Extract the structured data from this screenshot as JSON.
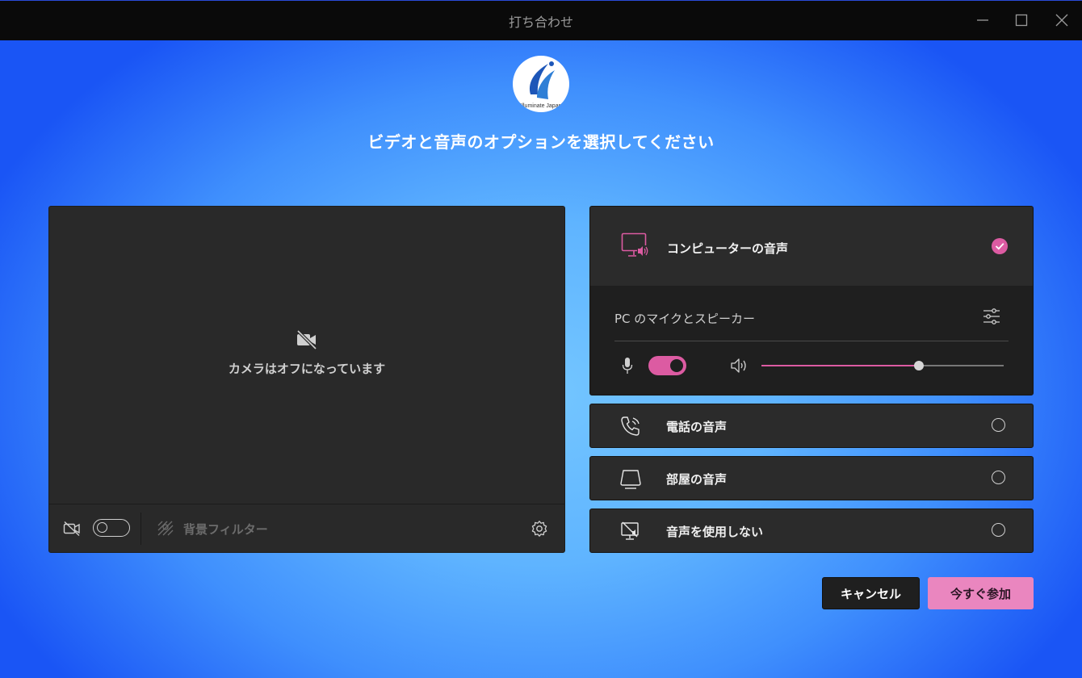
{
  "window": {
    "title": "打ち合わせ"
  },
  "logo": {
    "text": "Illuminate Japan"
  },
  "heading": "ビデオと音声のオプションを選択してください",
  "video": {
    "camera_off_label": "カメラはオフになっています",
    "background_filter_label": "背景フィルター",
    "camera_toggle_on": false
  },
  "audio": {
    "computer": {
      "label": "コンピューターの音声",
      "selected": true,
      "device_label": "PC のマイクとスピーカー",
      "mic_on": true,
      "volume": 0.65
    },
    "options": [
      {
        "label": "電話の音声",
        "icon": "phone-audio-icon",
        "selected": false
      },
      {
        "label": "部屋の音声",
        "icon": "room-audio-icon",
        "selected": false
      },
      {
        "label": "音声を使用しない",
        "icon": "no-audio-icon",
        "selected": false
      }
    ]
  },
  "buttons": {
    "cancel": "キャンセル",
    "join": "今すぐ参加"
  },
  "colors": {
    "accent": "#dc5ba2",
    "join_button": "#ea86bf",
    "panel": "#292929"
  }
}
